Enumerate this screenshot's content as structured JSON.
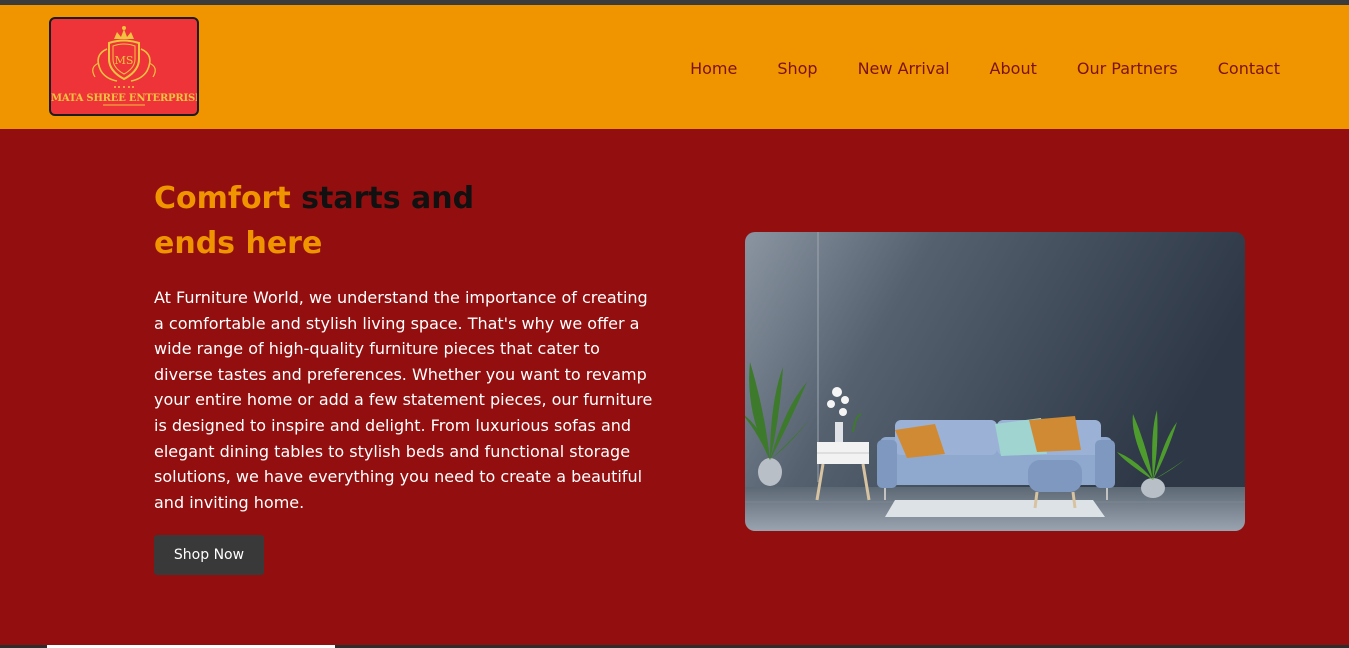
{
  "brand": {
    "logo_text": "MATA SHREE ENTERPRISES",
    "logo_monogram": "MS"
  },
  "nav": {
    "items": [
      "Home",
      "Shop",
      "New Arrival",
      "About",
      "Our Partners",
      "Contact"
    ]
  },
  "hero": {
    "title_accent_1": "Comfort",
    "title_dark": "starts and",
    "title_accent_2": "ends here",
    "description": "At Furniture World, we understand the importance of creating a comfortable and stylish living space. That's why we offer a wide range of high-quality furniture pieces that cater to diverse tastes and preferences. Whether you want to revamp your entire home or add a few statement pieces, our furniture is designed to inspire and delight. From luxurious sofas and elegant dining tables to stylish beds and functional storage solutions, we have everything you need to create a beautiful and inviting home.",
    "button_label": "Shop Now"
  },
  "colors": {
    "header_bg": "#f09500",
    "hero_bg": "#930f0f",
    "accent": "#f09500",
    "nav_text": "#7b1210",
    "button_bg": "#393939"
  }
}
